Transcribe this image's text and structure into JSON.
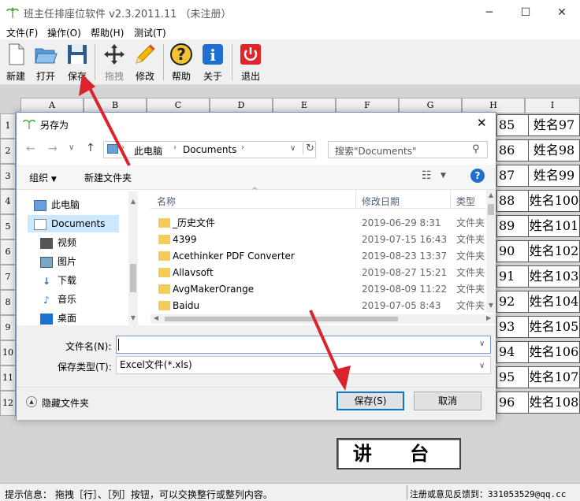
{
  "window": {
    "title": "班主任排座位软件 v2.3.2011.11 （未注册）"
  },
  "menu": [
    "文件(F)",
    "操作(O)",
    "帮助(H)",
    "测试(T)"
  ],
  "toolbar": {
    "new": "新建",
    "open": "打开",
    "save": "保存",
    "drag": "拖拽",
    "edit": "修改",
    "help": "帮助",
    "about": "关于",
    "exit": "退出"
  },
  "grid": {
    "columns": [
      "A",
      "B",
      "C",
      "D",
      "E",
      "F",
      "G",
      "H",
      "I"
    ],
    "rows": [
      "1",
      "2",
      "3",
      "4",
      "5",
      "6",
      "7",
      "8",
      "9",
      "10",
      "11",
      "12"
    ],
    "col_h": [
      "85",
      "86",
      "87",
      "88",
      "89",
      "90",
      "91",
      "92",
      "93",
      "94",
      "95",
      "96"
    ],
    "col_i": [
      "姓名97",
      "姓名98",
      "姓名99",
      "姓名100",
      "姓名101",
      "姓名102",
      "姓名103",
      "姓名104",
      "姓名105",
      "姓名106",
      "姓名107",
      "姓名108"
    ]
  },
  "podium": "讲 台",
  "status": {
    "hint": "提示信息： 拖拽［行］、［列］按钮，可以交换整行或整列内容。",
    "feedback": "注册或意见反馈到：331053529@qq.cc"
  },
  "dialog": {
    "title": "另存为",
    "path": [
      "此电脑",
      "Documents"
    ],
    "search_placeholder": "搜索\"Documents\"",
    "organize": "组织",
    "new_folder": "新建文件夹",
    "tree": [
      "此电脑",
      "Documents",
      "视频",
      "图片",
      "下载",
      "音乐",
      "桌面"
    ],
    "headers": {
      "name": "名称",
      "date": "修改日期",
      "type": "类型"
    },
    "files": [
      {
        "name": "_历史文件",
        "date": "2019-06-29 8:31",
        "type": "文件夹"
      },
      {
        "name": "4399",
        "date": "2019-07-15 16:43",
        "type": "文件夹"
      },
      {
        "name": "Acethinker PDF Converter",
        "date": "2019-08-23 13:37",
        "type": "文件夹"
      },
      {
        "name": "Allavsoft",
        "date": "2019-08-27 15:21",
        "type": "文件夹"
      },
      {
        "name": "AvgMakerOrange",
        "date": "2019-08-09 11:22",
        "type": "文件夹"
      },
      {
        "name": "Baidu",
        "date": "2019-07-05 8:43",
        "type": "文件夹"
      }
    ],
    "filename_label": "文件名(N):",
    "filename_value": "",
    "filetype_label": "保存类型(T):",
    "filetype_value": "Excel文件(*.xls)",
    "hide_folders": "隐藏文件夹",
    "save_button": "保存(S)",
    "cancel_button": "取消"
  },
  "colors": {
    "arrow": "#d9232d",
    "selection": "#cce8ff",
    "accent": "#0078d7"
  }
}
